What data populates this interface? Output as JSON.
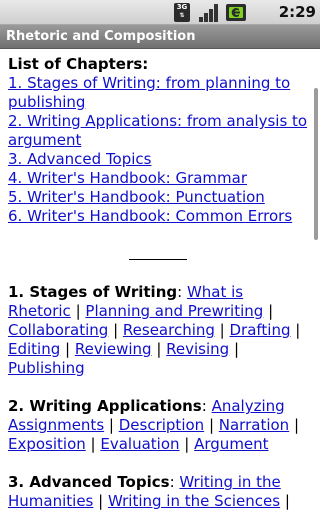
{
  "status_bar": {
    "network": "3G",
    "time": "2:29 PM"
  },
  "app": {
    "title": "Rhetoric and Composition"
  },
  "chapters": {
    "heading": "List of Chapters:",
    "items": [
      "1. Stages of Writing: from planning to publishing",
      "2. Writing Applications: from analysis to argument",
      "3. Advanced Topics",
      "4. Writer's Handbook: Grammar",
      "5. Writer's Handbook: Punctuation",
      "6. Writer's Handbook: Common Errors"
    ]
  },
  "sections": [
    {
      "title": "1. Stages of Writing",
      "links": [
        "What is Rhetoric",
        "Planning and Prewriting",
        "Collaborating",
        "Researching",
        "Drafting",
        "Editing",
        "Reviewing",
        "Revising",
        "Publishing"
      ]
    },
    {
      "title": "2. Writing Applications",
      "links": [
        "Analyzing Assignments",
        "Description",
        "Narration",
        "Exposition",
        "Evaluation",
        "Argument"
      ]
    },
    {
      "title": "3. Advanced Topics",
      "links": [
        "Writing in the Humanities",
        "Writing in the Sciences"
      ]
    }
  ],
  "colors": {
    "link": "#1010cc",
    "title_bar": "#808080"
  },
  "icons": {
    "network": "3g-icon",
    "signal": "signal-bars-icon",
    "battery": "battery-icon"
  }
}
